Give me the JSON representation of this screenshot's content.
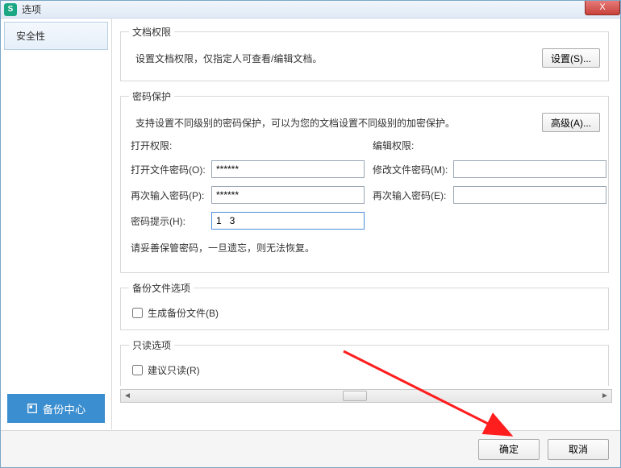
{
  "titlebar": {
    "title": "选项",
    "close": "X"
  },
  "sidebar": {
    "security": "安全性",
    "backup": "备份中心"
  },
  "doc_perm": {
    "legend": "文档权限",
    "desc": "设置文档权限，仅指定人可查看/编辑文档。",
    "btn": "设置(S)..."
  },
  "pwd": {
    "legend": "密码保护",
    "desc": "支持设置不同级别的密码保护，可以为您的文档设置不同级别的加密保护。",
    "btn": "高级(A)...",
    "open_perm": "打开权限:",
    "edit_perm": "编辑权限:",
    "open_pwd_lbl": "打开文件密码(O):",
    "open_pwd_val": "******",
    "modify_pwd_lbl": "修改文件密码(M):",
    "modify_pwd_val": "",
    "re_open_lbl": "再次输入密码(P):",
    "re_open_val": "******",
    "re_edit_lbl": "再次输入密码(E):",
    "re_edit_val": "",
    "hint_lbl": "密码提示(H):",
    "hint_val": "1   3",
    "note": "请妥善保管密码，一旦遗忘，则无法恢复。"
  },
  "backup_opt": {
    "legend": "备份文件选项",
    "gen": "生成备份文件(B)"
  },
  "readonly_opt": {
    "legend": "只读选项",
    "suggest": "建议只读(R)"
  },
  "footer": {
    "ok": "确定",
    "cancel": "取消"
  }
}
